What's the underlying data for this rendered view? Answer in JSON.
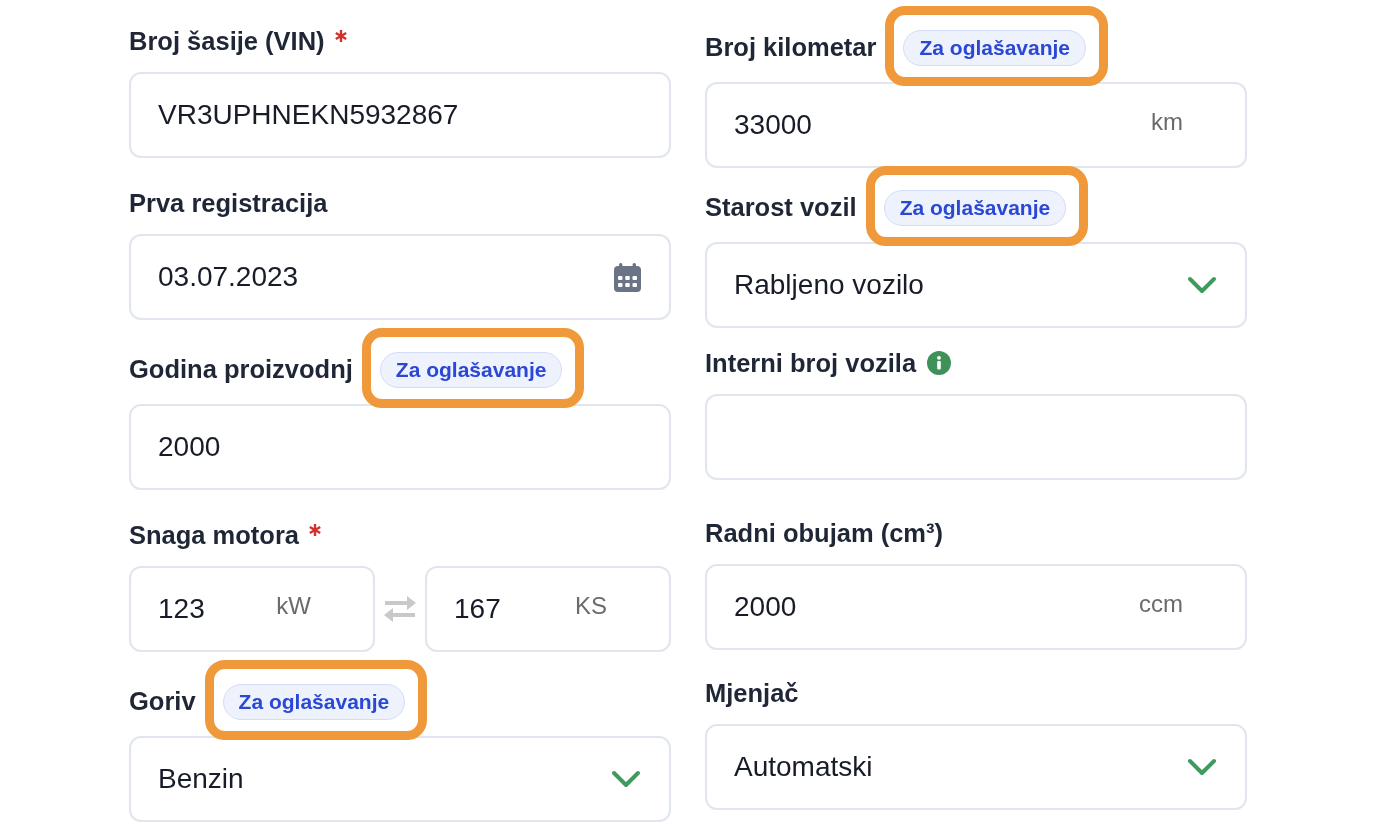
{
  "columns": [
    {
      "fields": [
        {
          "kind": "text",
          "label": "Broj šasije (VIN)",
          "required": true,
          "info": false,
          "value": "VR3UPHNEKN5932867"
        },
        {
          "kind": "date",
          "label": "Prva registracija",
          "required": false,
          "info": false,
          "value": "03.07.2023"
        },
        {
          "kind": "text",
          "label": "Godina proizvodnj",
          "required": false,
          "info": false,
          "tag": {
            "text": "Za oglašavanje",
            "highlighted": true
          },
          "value": "2000"
        },
        {
          "kind": "power",
          "label": "Snaga motora",
          "required": true,
          "info": false,
          "inputs": [
            {
              "value": "123",
              "unit": "kW"
            },
            {
              "value": "167",
              "unit": "KS"
            }
          ]
        },
        {
          "kind": "select",
          "label": "Goriv",
          "required": false,
          "info": false,
          "tag": {
            "text": "Za oglašavanje",
            "highlighted": true
          },
          "value": "Benzin"
        }
      ]
    },
    {
      "fields": [
        {
          "kind": "text",
          "label": "Broj kilometar",
          "required": false,
          "info": false,
          "tag": {
            "text": "Za oglašavanje",
            "highlighted": true
          },
          "value": "33000",
          "unit": "km"
        },
        {
          "kind": "select",
          "label": "Starost vozil",
          "required": false,
          "info": false,
          "tag": {
            "text": "Za oglašavanje",
            "highlighted": true
          },
          "value": "Rabljeno vozilo"
        },
        {
          "kind": "text",
          "label": "Interni broj vozila",
          "required": false,
          "info": true
        },
        {
          "kind": "text",
          "label": "Radni obujam (cm³)",
          "required": false,
          "info": false,
          "value": "2000",
          "unit": "ccm"
        },
        {
          "kind": "select",
          "label": "Mjenjač",
          "required": false,
          "info": false,
          "value": "Automatski"
        }
      ]
    }
  ]
}
